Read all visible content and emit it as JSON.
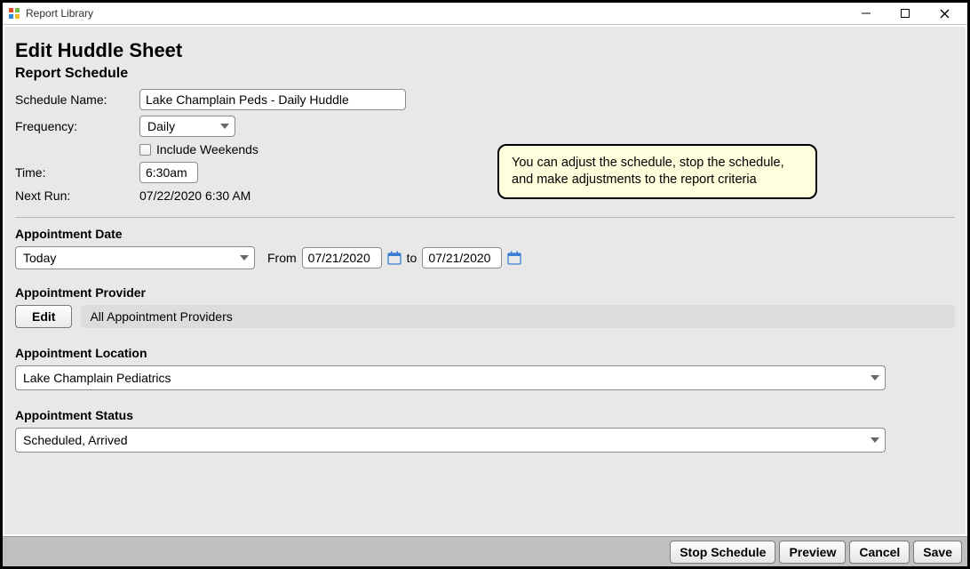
{
  "window": {
    "title": "Report Library"
  },
  "page": {
    "heading": "Edit Huddle Sheet",
    "subheading": "Report Schedule"
  },
  "schedule": {
    "name_label": "Schedule Name:",
    "name_value": "Lake Champlain Peds - Daily Huddle",
    "frequency_label": "Frequency:",
    "frequency_value": "Daily",
    "include_weekends_label": "Include Weekends",
    "time_label": "Time:",
    "time_value": "6:30am",
    "next_run_label": "Next Run:",
    "next_run_value": "07/22/2020 6:30 AM"
  },
  "appt_date": {
    "label": "Appointment Date",
    "preset": "Today",
    "from_label": "From",
    "from_value": "07/21/2020",
    "to_label": "to",
    "to_value": "07/21/2020"
  },
  "provider": {
    "label": "Appointment Provider",
    "edit_button": "Edit",
    "value": "All Appointment Providers"
  },
  "location": {
    "label": "Appointment Location",
    "value": "Lake Champlain Pediatrics"
  },
  "status": {
    "label": "Appointment Status",
    "value": "Scheduled, Arrived"
  },
  "callout": {
    "text": "You can adjust the schedule, stop the schedule, and make adjustments to the report criteria"
  },
  "footer": {
    "stop": "Stop Schedule",
    "preview": "Preview",
    "cancel": "Cancel",
    "save": "Save"
  }
}
